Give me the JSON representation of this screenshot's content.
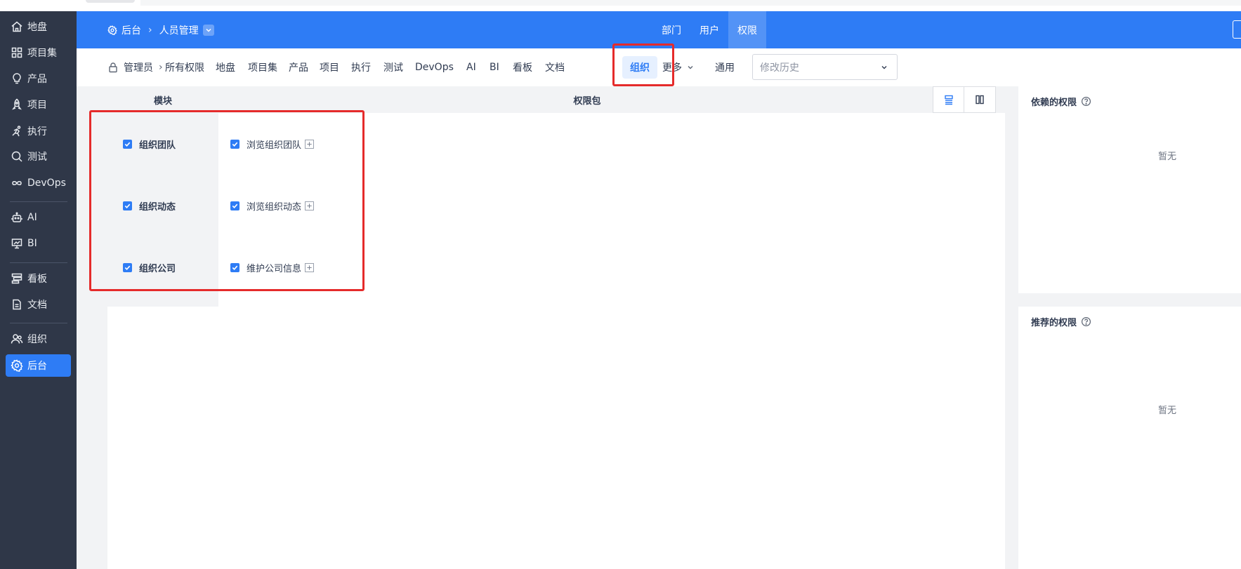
{
  "sidebar": {
    "items": [
      {
        "label": "地盘",
        "icon": "home-icon"
      },
      {
        "label": "项目集",
        "icon": "grid-icon"
      },
      {
        "label": "产品",
        "icon": "lightbulb-icon"
      },
      {
        "label": "项目",
        "icon": "rocket-icon"
      },
      {
        "label": "执行",
        "icon": "run-icon"
      },
      {
        "label": "测试",
        "icon": "search-check-icon"
      },
      {
        "label": "DevOps",
        "icon": "infinity-icon"
      },
      {
        "label": "AI",
        "icon": "robot-icon"
      },
      {
        "label": "BI",
        "icon": "chart-board-icon"
      },
      {
        "label": "看板",
        "icon": "kanban-icon"
      },
      {
        "label": "文档",
        "icon": "document-icon"
      },
      {
        "label": "组织",
        "icon": "users-icon"
      },
      {
        "label": "后台",
        "icon": "gear-icon",
        "active": true
      }
    ]
  },
  "header": {
    "breadcrumb_root": "后台",
    "breadcrumb_current": "人员管理",
    "tabs": [
      {
        "label": "部门"
      },
      {
        "label": "用户"
      },
      {
        "label": "权限",
        "active": true
      }
    ]
  },
  "toolbar": {
    "group_label": "管理员",
    "items": [
      "所有权限",
      "地盘",
      "项目集",
      "产品",
      "项目",
      "执行",
      "测试",
      "DevOps",
      "AI",
      "BI",
      "看板",
      "文档",
      "组织",
      "更多",
      "通用"
    ],
    "active_item": "组织",
    "history_placeholder": "修改历史"
  },
  "table": {
    "col_module": "模块",
    "col_package": "权限包",
    "rows": [
      {
        "module": "组织团队",
        "package": "浏览组织团队",
        "checked": true
      },
      {
        "module": "组织动态",
        "package": "浏览组织动态",
        "checked": true
      },
      {
        "module": "组织公司",
        "package": "维护公司信息",
        "checked": true
      }
    ]
  },
  "panels": {
    "depends_title": "依赖的权限",
    "depends_empty": "暂无",
    "recommend_title": "推荐的权限",
    "recommend_empty": "暂无"
  },
  "colors": {
    "primary": "#2e7cf5",
    "sidebar_bg": "#2f3748",
    "highlight": "#e52b2b"
  }
}
